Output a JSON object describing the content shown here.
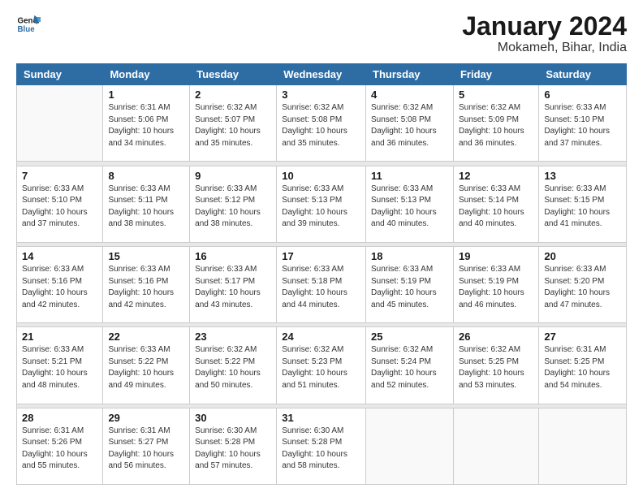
{
  "header": {
    "logo_line1": "General",
    "logo_line2": "Blue",
    "title": "January 2024",
    "subtitle": "Mokameh, Bihar, India"
  },
  "weekdays": [
    "Sunday",
    "Monday",
    "Tuesday",
    "Wednesday",
    "Thursday",
    "Friday",
    "Saturday"
  ],
  "weeks": [
    [
      {
        "day": "",
        "sunrise": "",
        "sunset": "",
        "daylight": ""
      },
      {
        "day": "1",
        "sunrise": "Sunrise: 6:31 AM",
        "sunset": "Sunset: 5:06 PM",
        "daylight": "Daylight: 10 hours and 34 minutes."
      },
      {
        "day": "2",
        "sunrise": "Sunrise: 6:32 AM",
        "sunset": "Sunset: 5:07 PM",
        "daylight": "Daylight: 10 hours and 35 minutes."
      },
      {
        "day": "3",
        "sunrise": "Sunrise: 6:32 AM",
        "sunset": "Sunset: 5:08 PM",
        "daylight": "Daylight: 10 hours and 35 minutes."
      },
      {
        "day": "4",
        "sunrise": "Sunrise: 6:32 AM",
        "sunset": "Sunset: 5:08 PM",
        "daylight": "Daylight: 10 hours and 36 minutes."
      },
      {
        "day": "5",
        "sunrise": "Sunrise: 6:32 AM",
        "sunset": "Sunset: 5:09 PM",
        "daylight": "Daylight: 10 hours and 36 minutes."
      },
      {
        "day": "6",
        "sunrise": "Sunrise: 6:33 AM",
        "sunset": "Sunset: 5:10 PM",
        "daylight": "Daylight: 10 hours and 37 minutes."
      }
    ],
    [
      {
        "day": "7",
        "sunrise": "Sunrise: 6:33 AM",
        "sunset": "Sunset: 5:10 PM",
        "daylight": "Daylight: 10 hours and 37 minutes."
      },
      {
        "day": "8",
        "sunrise": "Sunrise: 6:33 AM",
        "sunset": "Sunset: 5:11 PM",
        "daylight": "Daylight: 10 hours and 38 minutes."
      },
      {
        "day": "9",
        "sunrise": "Sunrise: 6:33 AM",
        "sunset": "Sunset: 5:12 PM",
        "daylight": "Daylight: 10 hours and 38 minutes."
      },
      {
        "day": "10",
        "sunrise": "Sunrise: 6:33 AM",
        "sunset": "Sunset: 5:13 PM",
        "daylight": "Daylight: 10 hours and 39 minutes."
      },
      {
        "day": "11",
        "sunrise": "Sunrise: 6:33 AM",
        "sunset": "Sunset: 5:13 PM",
        "daylight": "Daylight: 10 hours and 40 minutes."
      },
      {
        "day": "12",
        "sunrise": "Sunrise: 6:33 AM",
        "sunset": "Sunset: 5:14 PM",
        "daylight": "Daylight: 10 hours and 40 minutes."
      },
      {
        "day": "13",
        "sunrise": "Sunrise: 6:33 AM",
        "sunset": "Sunset: 5:15 PM",
        "daylight": "Daylight: 10 hours and 41 minutes."
      }
    ],
    [
      {
        "day": "14",
        "sunrise": "Sunrise: 6:33 AM",
        "sunset": "Sunset: 5:16 PM",
        "daylight": "Daylight: 10 hours and 42 minutes."
      },
      {
        "day": "15",
        "sunrise": "Sunrise: 6:33 AM",
        "sunset": "Sunset: 5:16 PM",
        "daylight": "Daylight: 10 hours and 42 minutes."
      },
      {
        "day": "16",
        "sunrise": "Sunrise: 6:33 AM",
        "sunset": "Sunset: 5:17 PM",
        "daylight": "Daylight: 10 hours and 43 minutes."
      },
      {
        "day": "17",
        "sunrise": "Sunrise: 6:33 AM",
        "sunset": "Sunset: 5:18 PM",
        "daylight": "Daylight: 10 hours and 44 minutes."
      },
      {
        "day": "18",
        "sunrise": "Sunrise: 6:33 AM",
        "sunset": "Sunset: 5:19 PM",
        "daylight": "Daylight: 10 hours and 45 minutes."
      },
      {
        "day": "19",
        "sunrise": "Sunrise: 6:33 AM",
        "sunset": "Sunset: 5:19 PM",
        "daylight": "Daylight: 10 hours and 46 minutes."
      },
      {
        "day": "20",
        "sunrise": "Sunrise: 6:33 AM",
        "sunset": "Sunset: 5:20 PM",
        "daylight": "Daylight: 10 hours and 47 minutes."
      }
    ],
    [
      {
        "day": "21",
        "sunrise": "Sunrise: 6:33 AM",
        "sunset": "Sunset: 5:21 PM",
        "daylight": "Daylight: 10 hours and 48 minutes."
      },
      {
        "day": "22",
        "sunrise": "Sunrise: 6:33 AM",
        "sunset": "Sunset: 5:22 PM",
        "daylight": "Daylight: 10 hours and 49 minutes."
      },
      {
        "day": "23",
        "sunrise": "Sunrise: 6:32 AM",
        "sunset": "Sunset: 5:22 PM",
        "daylight": "Daylight: 10 hours and 50 minutes."
      },
      {
        "day": "24",
        "sunrise": "Sunrise: 6:32 AM",
        "sunset": "Sunset: 5:23 PM",
        "daylight": "Daylight: 10 hours and 51 minutes."
      },
      {
        "day": "25",
        "sunrise": "Sunrise: 6:32 AM",
        "sunset": "Sunset: 5:24 PM",
        "daylight": "Daylight: 10 hours and 52 minutes."
      },
      {
        "day": "26",
        "sunrise": "Sunrise: 6:32 AM",
        "sunset": "Sunset: 5:25 PM",
        "daylight": "Daylight: 10 hours and 53 minutes."
      },
      {
        "day": "27",
        "sunrise": "Sunrise: 6:31 AM",
        "sunset": "Sunset: 5:25 PM",
        "daylight": "Daylight: 10 hours and 54 minutes."
      }
    ],
    [
      {
        "day": "28",
        "sunrise": "Sunrise: 6:31 AM",
        "sunset": "Sunset: 5:26 PM",
        "daylight": "Daylight: 10 hours and 55 minutes."
      },
      {
        "day": "29",
        "sunrise": "Sunrise: 6:31 AM",
        "sunset": "Sunset: 5:27 PM",
        "daylight": "Daylight: 10 hours and 56 minutes."
      },
      {
        "day": "30",
        "sunrise": "Sunrise: 6:30 AM",
        "sunset": "Sunset: 5:28 PM",
        "daylight": "Daylight: 10 hours and 57 minutes."
      },
      {
        "day": "31",
        "sunrise": "Sunrise: 6:30 AM",
        "sunset": "Sunset: 5:28 PM",
        "daylight": "Daylight: 10 hours and 58 minutes."
      },
      {
        "day": "",
        "sunrise": "",
        "sunset": "",
        "daylight": ""
      },
      {
        "day": "",
        "sunrise": "",
        "sunset": "",
        "daylight": ""
      },
      {
        "day": "",
        "sunrise": "",
        "sunset": "",
        "daylight": ""
      }
    ]
  ]
}
